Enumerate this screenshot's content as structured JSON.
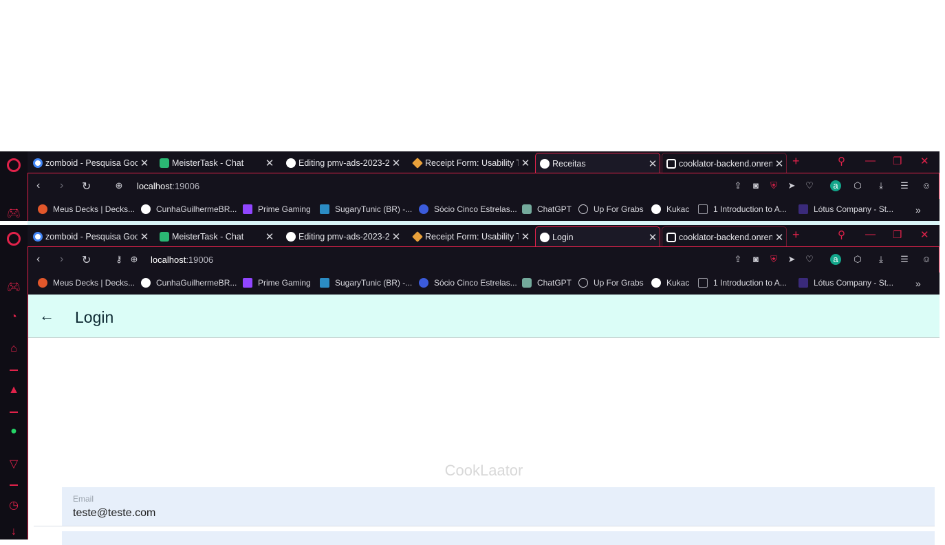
{
  "browser": {
    "windows": [
      {
        "tabs": [
          {
            "title": "zomboid - Pesquisa Goo",
            "color": "#4285f4"
          },
          {
            "title": "MeisterTask - Chat",
            "color": "#2bb673"
          },
          {
            "title": "Editing pmv-ads-2023-2",
            "color": "#ffffff"
          },
          {
            "title": "Receipt Form: Usability T",
            "color": "#e9a13b"
          },
          {
            "title": "Receitas",
            "color": "#ffffff"
          },
          {
            "title": "cooklator-backend.onren",
            "color": "#ffffff"
          }
        ],
        "url_host": "localhost",
        "url_port": ":19006"
      },
      {
        "tabs": [
          {
            "title": "zomboid - Pesquisa Goo",
            "color": "#4285f4"
          },
          {
            "title": "MeisterTask - Chat",
            "color": "#2bb673"
          },
          {
            "title": "Editing pmv-ads-2023-2",
            "color": "#ffffff"
          },
          {
            "title": "Receipt Form: Usability T",
            "color": "#e9a13b"
          },
          {
            "title": "Login",
            "color": "#ffffff"
          },
          {
            "title": "cooklator-backend.onren",
            "color": "#ffffff"
          }
        ],
        "url_host": "localhost",
        "url_port": ":19006"
      }
    ],
    "bookmarks": [
      {
        "label": "Meus Decks | Decks...",
        "color": "#e2572b"
      },
      {
        "label": "CunhaGuilhermeBR...",
        "color": "#ffffff"
      },
      {
        "label": "Prime Gaming",
        "color": "#9146ff"
      },
      {
        "label": "SugaryTunic (BR) -...",
        "color": "#2b8cc4"
      },
      {
        "label": "Sócio Cinco Estrelas...",
        "color": "#3b5bdb"
      },
      {
        "label": "ChatGPT",
        "color": "#74aa9c"
      },
      {
        "label": "Up For Grabs",
        "color": "#14121c"
      },
      {
        "label": "Kukac",
        "color": "#ffffff"
      },
      {
        "label": "1 Introduction to A...",
        "color": "#9a9aa3"
      },
      {
        "label": "Lótus Company - St...",
        "color": "#3a2a7a"
      }
    ],
    "bookmarks_more": "»",
    "accent": "#e0224a"
  },
  "app": {
    "header": {
      "title": "Login",
      "back_icon": "arrow-left-icon"
    },
    "brand": "CookLaator",
    "form": {
      "email_label": "Email",
      "email_value": "teste@teste.com"
    }
  }
}
